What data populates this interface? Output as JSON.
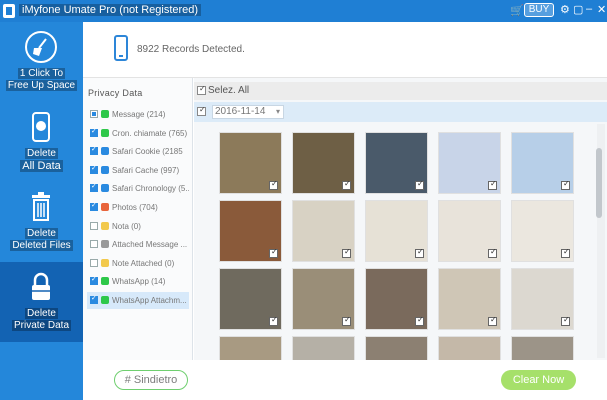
{
  "window": {
    "title": "iMyfone Umate Pro (not Registered)",
    "buy_label": "BUY",
    "cart_icon": "cart-icon",
    "controls": [
      "settings-icon",
      "chat-icon",
      "minimize-icon",
      "close-icon"
    ]
  },
  "sidebar": {
    "items": [
      {
        "line1": "1 Click To",
        "line2": "Free Up Space",
        "icon": "broom-icon"
      },
      {
        "line1": "Delete",
        "line2": "All Data",
        "icon": "phone-erase-icon"
      },
      {
        "line1": "Delete",
        "line2": "Deleted Files",
        "icon": "trash-icon"
      },
      {
        "line1": "Delete",
        "line2": "Private Data",
        "icon": "lock-icon"
      }
    ],
    "active": 3
  },
  "header": {
    "records": "8922 Records Detected."
  },
  "categories": {
    "title": "Privacy Data",
    "items": [
      {
        "label": "Message (214)",
        "state": "partial",
        "color": "#2ec84a"
      },
      {
        "label": "Cron. chiamate (765)",
        "state": "checked",
        "color": "#2ec84a"
      },
      {
        "label": "Safari Cookie (2185",
        "state": "checked",
        "color": "#2a8ae0"
      },
      {
        "label": "Safari Cache (997)",
        "state": "checked",
        "color": "#2a8ae0"
      },
      {
        "label": "Safari Chronology (5...",
        "state": "checked",
        "color": "#2a8ae0"
      },
      {
        "label": "Photos (704)",
        "state": "checked",
        "color": "#e8643b"
      },
      {
        "label": "Nota (0)",
        "state": "unchecked",
        "color": "#f2c94c"
      },
      {
        "label": "Attached Message ...",
        "state": "unchecked",
        "color": "#999999"
      },
      {
        "label": "Note Attached (0)",
        "state": "unchecked",
        "color": "#f2c94c"
      },
      {
        "label": "WhatsApp (14)",
        "state": "checked",
        "color": "#2ec84a"
      },
      {
        "label": "WhatsApp Attachm...",
        "state": "checked",
        "color": "#2ec84a"
      }
    ],
    "selected": 10
  },
  "grid": {
    "select_all": "Selez. All",
    "date": "2016-11-14",
    "thumbs": [
      {
        "bg": "#8c7a5a"
      },
      {
        "bg": "#6e5f45"
      },
      {
        "bg": "#4a5a6a"
      },
      {
        "bg": "#c8d4e8"
      },
      {
        "bg": "#b7cfe8"
      },
      {
        "bg": "#8a5a3a"
      },
      {
        "bg": "#d8d2c4"
      },
      {
        "bg": "#e6e1d6"
      },
      {
        "bg": "#e8e3da"
      },
      {
        "bg": "#ebe7df"
      },
      {
        "bg": "#6f6a5e"
      },
      {
        "bg": "#9a8e78"
      },
      {
        "bg": "#7a6a5c"
      },
      {
        "bg": "#cfc6b6"
      },
      {
        "bg": "#dcd8d0"
      },
      {
        "bg": "#a89a82"
      },
      {
        "bg": "#b5b0a6"
      },
      {
        "bg": "#8c8072"
      },
      {
        "bg": "#c4b8a8"
      },
      {
        "bg": "#9c9488"
      }
    ]
  },
  "footer": {
    "back_label": "# Sindietro",
    "clear_label": "Clear Now"
  }
}
